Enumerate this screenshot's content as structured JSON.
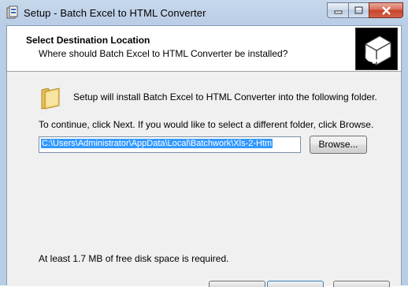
{
  "window": {
    "title": "Setup - Batch Excel to HTML Converter",
    "buttons": {
      "minimize": "minimize-icon",
      "maximize": "maximize-icon",
      "close": "close-icon"
    }
  },
  "header": {
    "title": "Select Destination Location",
    "subtitle": "Where should Batch Excel to HTML Converter be installed?"
  },
  "body": {
    "install_text": "Setup will install Batch Excel to HTML Converter into the following folder.",
    "continue_text": "To continue, click Next. If you would like to select a different folder, click Browse.",
    "path_value": "C:\\Users\\Administrator\\AppData\\Local\\Batchwork\\Xls-2-Htm",
    "browse_label": "Browse...",
    "space_text": "At least 1.7 MB of free disk space is required."
  },
  "colors": {
    "selection": "#3399ff",
    "close_button": "#c7432a",
    "title_bar": "#b9cde6"
  }
}
